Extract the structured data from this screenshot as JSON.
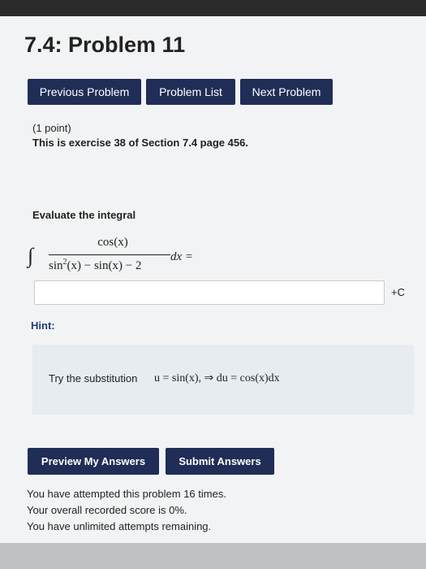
{
  "page": {
    "title": "7.4: Problem 11"
  },
  "nav": {
    "previous_label": "Previous Problem",
    "list_label": "Problem List",
    "next_label": "Next Problem"
  },
  "problem": {
    "points": "(1 point)",
    "exercise_ref": "This is exercise 38 of Section 7.4 page 456.",
    "evaluate_text": "Evaluate the integral",
    "integral": {
      "sign": "∫",
      "numerator": "cos(x)",
      "denominator_sin": "sin",
      "denominator_exp": "2",
      "denominator_rest": "(x) − sin(x) − 2",
      "dx_equals": "dx ="
    },
    "answer": {
      "value": "",
      "suffix": "+C"
    },
    "hint_label": "Hint:",
    "hint_text": "Try the substitution",
    "hint_math": "u = sin(x),  ⇒  du = cos(x)dx"
  },
  "actions": {
    "preview_label": "Preview My Answers",
    "submit_label": "Submit Answers"
  },
  "status": {
    "attempts": "You have attempted this problem 16 times.",
    "score": "Your overall recorded score is 0%.",
    "remaining": "You have unlimited attempts remaining."
  },
  "colors": {
    "button_bg": "#1f2d57",
    "button_text": "#ffffff",
    "hint_label": "#1f3d7a",
    "hint_box": "#e7ecf0"
  }
}
